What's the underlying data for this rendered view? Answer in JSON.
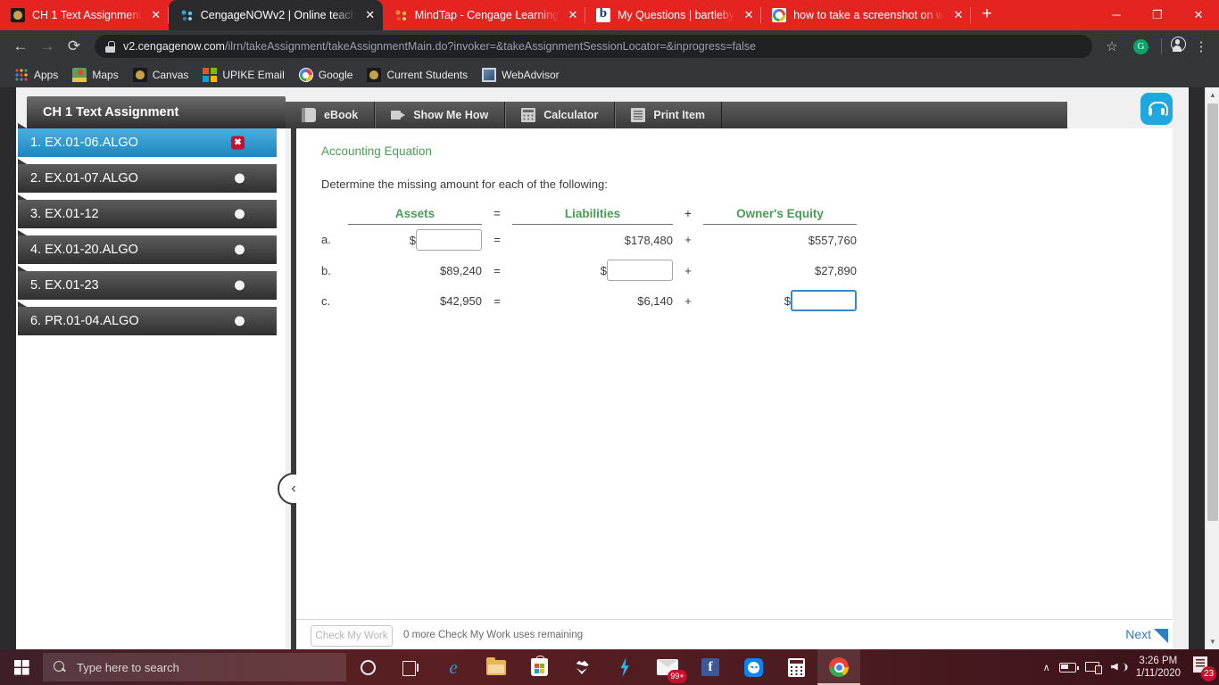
{
  "browser": {
    "tabs": [
      {
        "title": "CH 1 Text Assignment",
        "favicon": "panther-icon",
        "active": false
      },
      {
        "title": "CengageNOWv2 | Online teach",
        "favicon": "cengage-icon",
        "active": true
      },
      {
        "title": "MindTap - Cengage Learning",
        "favicon": "mindtap-icon",
        "active": false
      },
      {
        "title": "My Questions | bartleby",
        "favicon": "bartleby-icon",
        "active": false
      },
      {
        "title": "how to take a screenshot on w",
        "favicon": "google-icon",
        "active": false
      }
    ],
    "tab_close_label": "✕",
    "newtab_label": "+",
    "window_controls": {
      "minimize": "─",
      "maximize": "❐",
      "close": "✕"
    },
    "nav": {
      "back": "←",
      "forward": "→",
      "reload": "⟳"
    },
    "omnibox": {
      "host": "v2.cengagenow.com",
      "path": "/ilrn/takeAssignment/takeAssignmentMain.do?invoker=&takeAssignmentSessionLocator=&inprogress=false",
      "full_url": "v2.cengagenow.com/ilrn/takeAssignment/takeAssignmentMain.do?invoker=&takeAssignmentSessionLocator=&inprogress=false"
    },
    "star_label": "☆",
    "profile_badge": "G",
    "menu_label": "⋮",
    "bookmarks": [
      {
        "label": "Apps",
        "icon": "apps-grid-icon"
      },
      {
        "label": "Maps",
        "icon": "maps-icon"
      },
      {
        "label": "Canvas",
        "icon": "canvas-icon"
      },
      {
        "label": "UPIKE Email",
        "icon": "microsoft-icon"
      },
      {
        "label": "Google",
        "icon": "google-icon"
      },
      {
        "label": "Current Students",
        "icon": "canvas-icon"
      },
      {
        "label": "WebAdvisor",
        "icon": "webadvisor-icon"
      }
    ]
  },
  "app": {
    "assignment_title": "CH 1 Text Assignment",
    "tools": [
      {
        "label": "eBook",
        "icon": "book-icon"
      },
      {
        "label": "Show Me How",
        "icon": "video-icon"
      },
      {
        "label": "Calculator",
        "icon": "calculator-icon"
      },
      {
        "label": "Print Item",
        "icon": "print-icon"
      }
    ],
    "support_button": "headset-icon",
    "collapse_button": "‹"
  },
  "sidebar": {
    "items": [
      {
        "label": "1. EX.01-06.ALGO",
        "status": "wrong",
        "status_glyph": "✖",
        "active": true
      },
      {
        "label": "2. EX.01-07.ALGO",
        "status": "unanswered",
        "status_glyph": "",
        "active": false
      },
      {
        "label": "3. EX.01-12",
        "status": "unanswered",
        "status_glyph": "",
        "active": false
      },
      {
        "label": "4. EX.01-20.ALGO",
        "status": "unanswered",
        "status_glyph": "",
        "active": false
      },
      {
        "label": "5. EX.01-23",
        "status": "unanswered",
        "status_glyph": "",
        "active": false
      },
      {
        "label": "6. PR.01-04.ALGO",
        "status": "unanswered",
        "status_glyph": "",
        "active": false
      }
    ]
  },
  "content": {
    "heading": "Accounting Equation",
    "prompt": "Determine the missing amount for each of the following:",
    "columns": {
      "assets": "Assets",
      "equals": "=",
      "liabilities": "Liabilities",
      "plus": "+",
      "owners_equity": "Owner's Equity"
    },
    "currency_symbol": "$",
    "rows": [
      {
        "label": "a.",
        "assets": {
          "type": "input",
          "value": "",
          "focused": false
        },
        "eq": "=",
        "liabilities": {
          "type": "text",
          "value": "$178,480"
        },
        "op": "+",
        "owners_equity": {
          "type": "text",
          "value": "$557,760"
        }
      },
      {
        "label": "b.",
        "assets": {
          "type": "text",
          "value": "$89,240"
        },
        "eq": "=",
        "liabilities": {
          "type": "input",
          "value": "",
          "focused": false
        },
        "op": "+",
        "owners_equity": {
          "type": "text",
          "value": "$27,890"
        }
      },
      {
        "label": "c.",
        "assets": {
          "type": "text",
          "value": "$42,950"
        },
        "eq": "=",
        "liabilities": {
          "type": "text",
          "value": "$6,140"
        },
        "op": "+",
        "owners_equity": {
          "type": "input",
          "value": "",
          "focused": true
        }
      }
    ]
  },
  "footer": {
    "check_button": "Check My Work",
    "check_note": "0 more Check My Work uses remaining",
    "next_label": "Next"
  },
  "taskbar": {
    "start": "windows-logo-icon",
    "search_placeholder": "Type here to search",
    "cortana": "cortana-icon",
    "task_view": "task-view-icon",
    "pinned": [
      {
        "name": "edge-icon",
        "glyph": "e"
      },
      {
        "name": "file-explorer-icon",
        "glyph": ""
      },
      {
        "name": "microsoft-store-icon",
        "glyph": ""
      },
      {
        "name": "dropbox-icon",
        "glyph": ""
      },
      {
        "name": "lightning-app-icon",
        "glyph": ""
      },
      {
        "name": "mail-icon",
        "glyph": "",
        "badge": "99+"
      },
      {
        "name": "facebook-icon",
        "glyph": "f"
      },
      {
        "name": "messenger-icon",
        "glyph": ""
      },
      {
        "name": "calculator-icon",
        "glyph": ""
      },
      {
        "name": "chrome-icon",
        "glyph": "",
        "active": true
      }
    ],
    "tray": {
      "chevron": "∧",
      "battery": "battery-icon",
      "network": "network-icon",
      "volume": "volume-icon",
      "time": "3:26 PM",
      "date": "1/11/2020",
      "notification_count": "23"
    }
  }
}
